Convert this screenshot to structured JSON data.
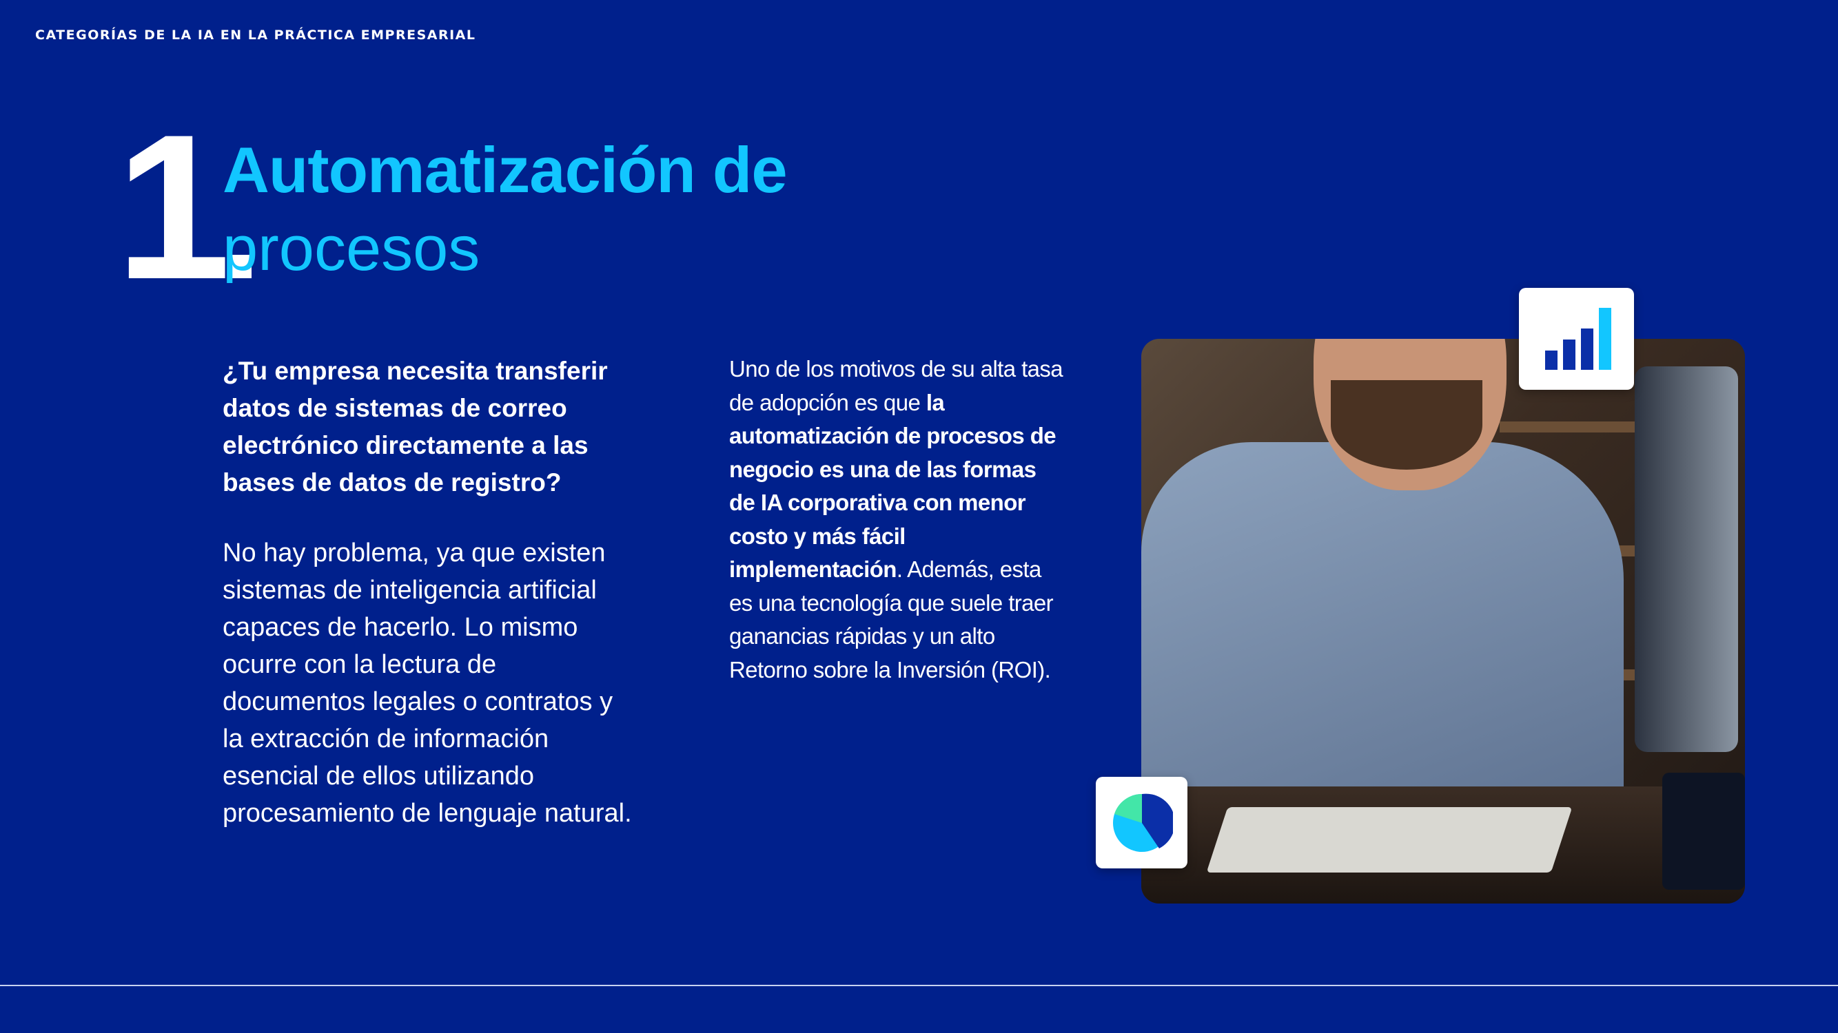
{
  "header": {
    "kicker": "CATEGORÍAS DE LA IA EN LA PRÁCTICA EMPRESARIAL"
  },
  "section": {
    "number": "1",
    "title_line1": "Automatización de",
    "title_line2": "procesos"
  },
  "left_column": {
    "question": "¿Tu empresa necesita transferir datos de sistemas de correo electrónico directamente a las bases de datos de registro?",
    "answer": "No hay problema, ya que existen sistemas de inteligencia artificial capaces de hacerlo. Lo mismo ocurre con la lectura de documentos legales o contratos y la extracción de información esencial de ellos utilizando procesamiento de lenguaje natural."
  },
  "middle_column": {
    "part1": "Uno de los motivos de su alta tasa de adopción es que ",
    "bold": "la automatización de procesos de negocio es una de las formas de IA corporativa con menor costo y más fácil implementación",
    "part2": ". Además, esta es una tecnología que suele traer ganancias rápidas y un alto Retorno sobre la Inversión (ROI)."
  },
  "icons": {
    "chart": "bar-chart-icon",
    "pie": "pie-chart-icon"
  },
  "colors": {
    "background": "#00208c",
    "accent": "#12c6ff",
    "text": "#ffffff"
  }
}
